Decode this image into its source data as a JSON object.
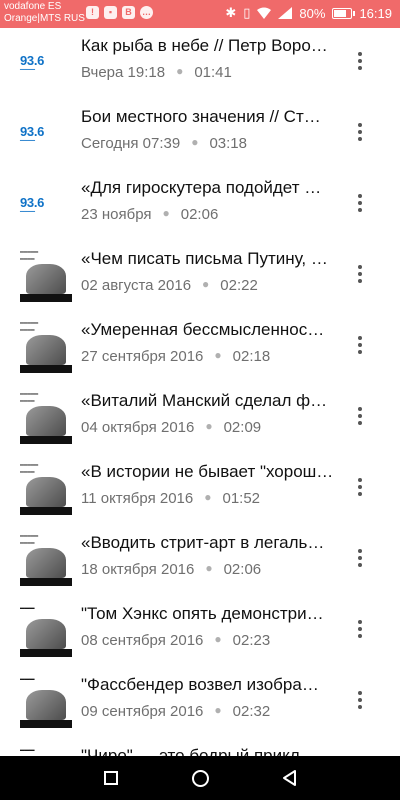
{
  "status_bar": {
    "carrier1": "vodafone ES",
    "carrier2": "Orange|MTS RUS",
    "battery_percent": "80%",
    "battery_level": 0.8,
    "time": "16:19",
    "left_icons": [
      "notification-icon",
      "image-icon",
      "vk-icon",
      "chat-icon"
    ],
    "right_icons": [
      "bluetooth-icon",
      "vibrate-icon",
      "wifi-icon",
      "signal-icon",
      "battery-icon"
    ]
  },
  "episodes": [
    {
      "title": "Как рыба в небе // Петр Воро…",
      "date": "Вчера 19:18",
      "duration": "01:41",
      "thumb": "936",
      "thumb_text": "93.6"
    },
    {
      "title": "Бои местного значения // Ст…",
      "date": "Сегодня 07:39",
      "duration": "03:18",
      "thumb": "936",
      "thumb_text": "93.6"
    },
    {
      "title": "«Для гироскутера подойдет …",
      "date": "23 ноября",
      "duration": "02:06",
      "thumb": "936",
      "thumb_text": "93.6"
    },
    {
      "title": "«Чем писать письма Путину, …",
      "date": "02 августа 2016",
      "duration": "02:22",
      "thumb": "gubin"
    },
    {
      "title": "«Умеренная бессмысленнос…",
      "date": "27 сентября 2016",
      "duration": "02:18",
      "thumb": "gubin"
    },
    {
      "title": "«Виталий Манский сделал ф…",
      "date": "04 октября 2016",
      "duration": "02:09",
      "thumb": "gubin"
    },
    {
      "title": "«В истории не бывает \"хорош…",
      "date": "11 октября 2016",
      "duration": "01:52",
      "thumb": "gubin"
    },
    {
      "title": "«Вводить стрит-арт в легаль…",
      "date": "18 октября 2016",
      "duration": "02:06",
      "thumb": "gubin"
    },
    {
      "title": "\"Том Хэнкс опять демонстри…",
      "date": "08 сентября 2016",
      "duration": "02:23",
      "thumb": "kino"
    },
    {
      "title": "\"Фассбендер возвел изобра…",
      "date": "09 сентября 2016",
      "duration": "02:32",
      "thumb": "kino"
    },
    {
      "title": "\"Чиро\" — это бодрый прикл…",
      "date": "",
      "duration": "",
      "thumb": "kino"
    }
  ],
  "nav": {
    "recents": "square-icon",
    "home": "circle-icon",
    "back": "triangle-back-icon"
  }
}
